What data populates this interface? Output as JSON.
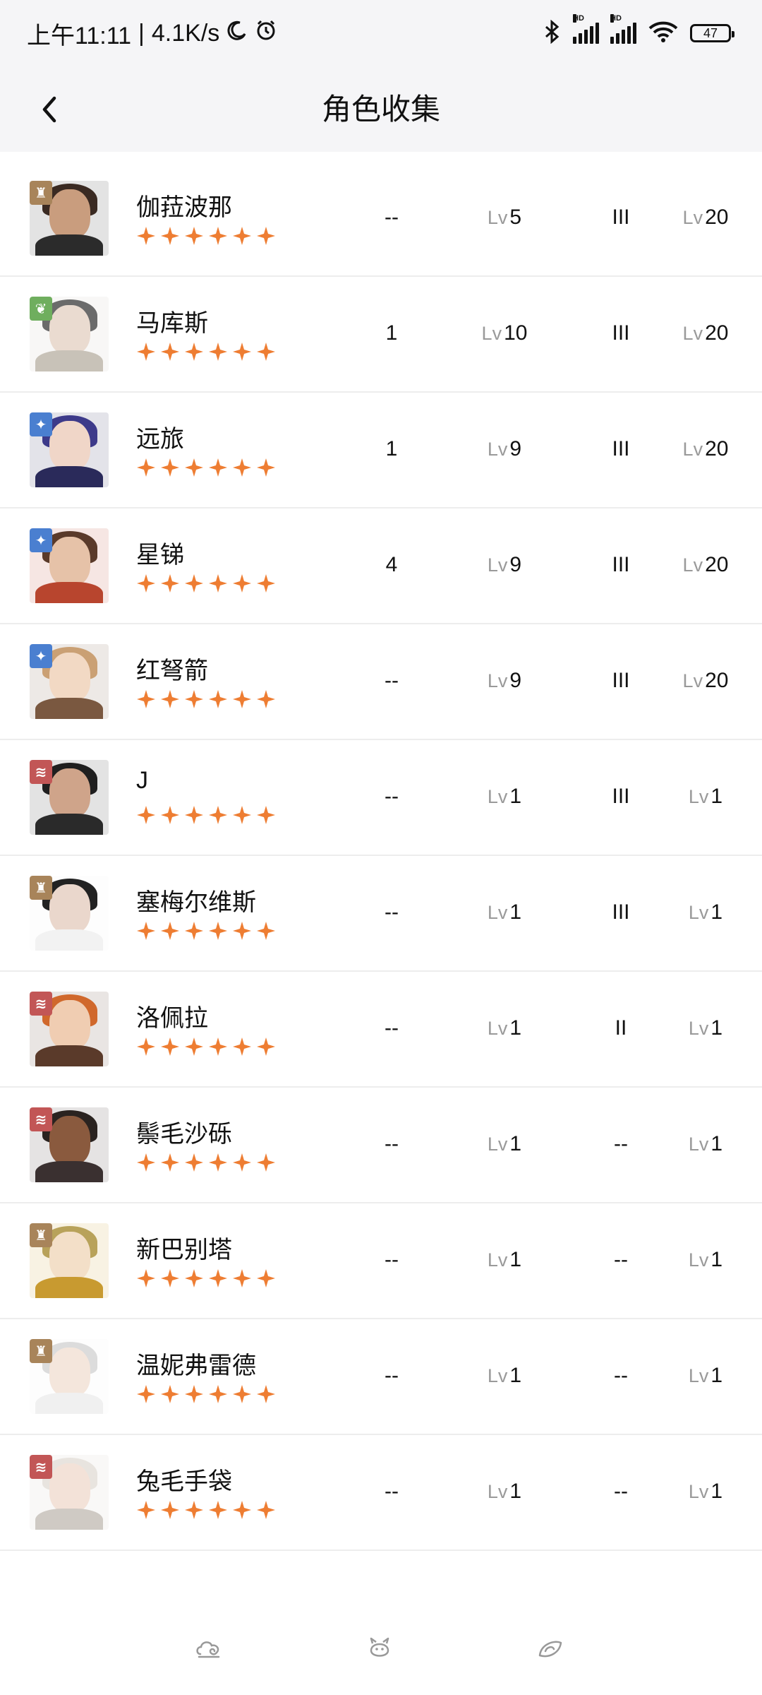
{
  "status_bar": {
    "time": "上午11:11",
    "net_speed": "4.1K/s",
    "battery": "47",
    "hd1": "HD",
    "hd2": "HD"
  },
  "header": {
    "title": "角色收集"
  },
  "icons": {
    "back": "chevron-left-icon",
    "tabs": [
      "cloud-swirl-icon",
      "creature-icon",
      "leaf-swirl-icon"
    ]
  },
  "colors": {
    "star": "#ee7d32",
    "element_beast": "#a8845a",
    "element_plant": "#6fae5e",
    "element_star": "#4a7fd0",
    "element_passion": "#c25656",
    "divider": "#ededed"
  },
  "lv_label": "Lv",
  "characters": [
    {
      "name": "伽菈波那",
      "stars": 6,
      "element": "beast",
      "col_a": "--",
      "col_b": "5",
      "col_c": "III",
      "col_d": "20"
    },
    {
      "name": "马库斯",
      "stars": 6,
      "element": "plant",
      "col_a": "1",
      "col_b": "10",
      "col_c": "III",
      "col_d": "20"
    },
    {
      "name": "远旅",
      "stars": 6,
      "element": "star",
      "col_a": "1",
      "col_b": "9",
      "col_c": "III",
      "col_d": "20"
    },
    {
      "name": "星锑",
      "stars": 6,
      "element": "star",
      "col_a": "4",
      "col_b": "9",
      "col_c": "III",
      "col_d": "20"
    },
    {
      "name": "红弩箭",
      "stars": 6,
      "element": "star",
      "col_a": "--",
      "col_b": "9",
      "col_c": "III",
      "col_d": "20"
    },
    {
      "name": "J",
      "stars": 6,
      "element": "passion",
      "col_a": "--",
      "col_b": "1",
      "col_c": "III",
      "col_d": "1"
    },
    {
      "name": "塞梅尔维斯",
      "stars": 6,
      "element": "beast",
      "col_a": "--",
      "col_b": "1",
      "col_c": "III",
      "col_d": "1"
    },
    {
      "name": "洛佩拉",
      "stars": 6,
      "element": "passion",
      "col_a": "--",
      "col_b": "1",
      "col_c": "II",
      "col_d": "1"
    },
    {
      "name": "鬃毛沙砾",
      "stars": 6,
      "element": "passion",
      "col_a": "--",
      "col_b": "1",
      "col_c": "--",
      "col_d": "1"
    },
    {
      "name": "新巴别塔",
      "stars": 6,
      "element": "beast",
      "col_a": "--",
      "col_b": "1",
      "col_c": "--",
      "col_d": "1"
    },
    {
      "name": "温妮弗雷德",
      "stars": 6,
      "element": "beast",
      "col_a": "--",
      "col_b": "1",
      "col_c": "--",
      "col_d": "1"
    },
    {
      "name": "兔毛手袋",
      "stars": 6,
      "element": "passion",
      "col_a": "--",
      "col_b": "1",
      "col_c": "--",
      "col_d": "1"
    }
  ]
}
